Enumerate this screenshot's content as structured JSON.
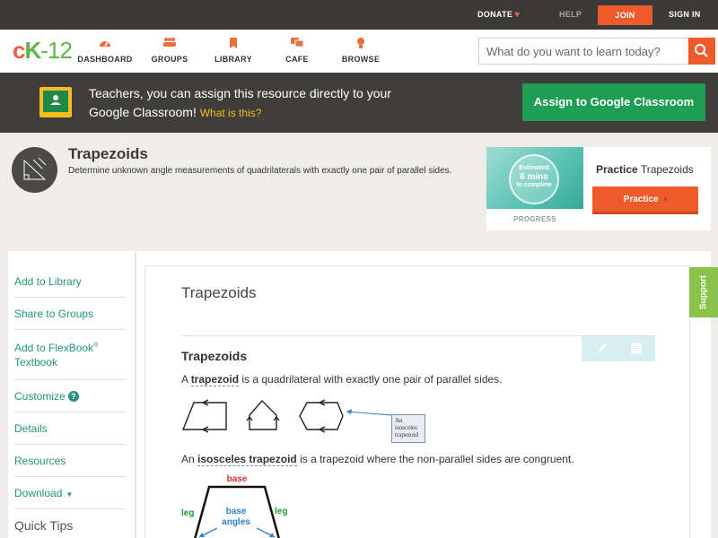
{
  "topbar": {
    "donate": "DONATE",
    "help": "HELP",
    "join": "JOIN",
    "signin": "SIGN IN"
  },
  "nav": {
    "logo": {
      "c": "c",
      "k": "K",
      "rest": "-12"
    },
    "items": [
      {
        "label": "DASHBOARD",
        "icon": "dashboard-icon"
      },
      {
        "label": "GROUPS",
        "icon": "groups-icon"
      },
      {
        "label": "LIBRARY",
        "icon": "library-icon"
      },
      {
        "label": "CAFE",
        "icon": "cafe-icon"
      },
      {
        "label": "BROWSE",
        "icon": "browse-icon"
      }
    ],
    "search_placeholder": "What do you want to learn today?"
  },
  "banner": {
    "text": "Teachers, you can assign this resource directly to your Google Classroom!",
    "link": "What is this?",
    "button": "Assign to Google Classroom"
  },
  "concept": {
    "title": "Trapezoids",
    "description": "Determine unknown angle measurements of quadrilaterals with exactly one pair of parallel sides.",
    "practice": {
      "estimated": "Estimated",
      "mins": "6 mins",
      "to_complete": "to complete",
      "progress": "PROGRESS",
      "heading_bold": "Practice",
      "heading_rest": " Trapezoids",
      "button": "Practice"
    }
  },
  "sidebar": {
    "add_library": "Add to Library",
    "share_groups": "Share to Groups",
    "add_flexbook": "Add to FlexBook",
    "reg": "®",
    "textbook": "Textbook",
    "customize": "Customize",
    "qmark": "?",
    "details": "Details",
    "resources": "Resources",
    "download": "Download",
    "quick_tips": "Quick Tips"
  },
  "content": {
    "title": "Trapezoids",
    "section_title": "Trapezoids",
    "p1_a": "A ",
    "p1_term": "trapezoid",
    "p1_b": " is a quadrilateral with exactly one pair of parallel sides.",
    "callout_line1": "An",
    "callout_line2": "isosceles",
    "callout_line3": "trapezoid",
    "p2_a": "An ",
    "p2_term": "isosceles trapezoid",
    "p2_b": " is a trapezoid where the non-parallel sides are congruent.",
    "diagram": {
      "base": "base",
      "leg_left": "leg",
      "leg_right": "leg",
      "base_angles_1": "base",
      "base_angles_2": "angles"
    }
  },
  "support": "Support",
  "colors": {
    "accent_orange": "#ef5a2b",
    "teal_link": "#23947c",
    "google_green": "#1e9e55",
    "support_green": "#8bc34a"
  }
}
